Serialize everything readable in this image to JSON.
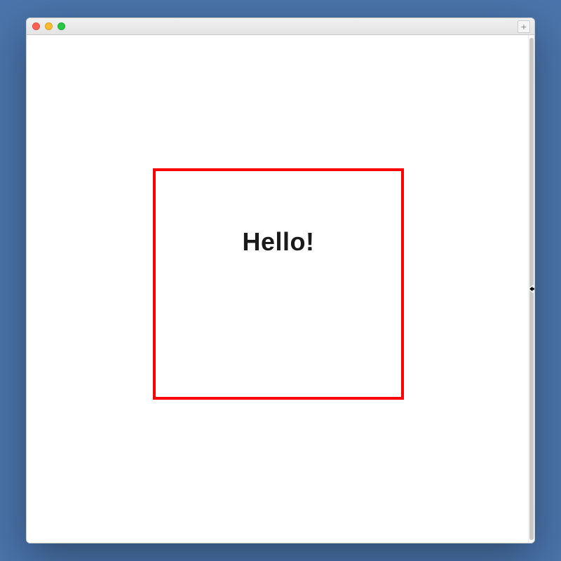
{
  "window": {
    "titlebar": {
      "new_tab_glyph": "+"
    }
  },
  "content": {
    "box": {
      "greeting": "Hello!"
    }
  }
}
